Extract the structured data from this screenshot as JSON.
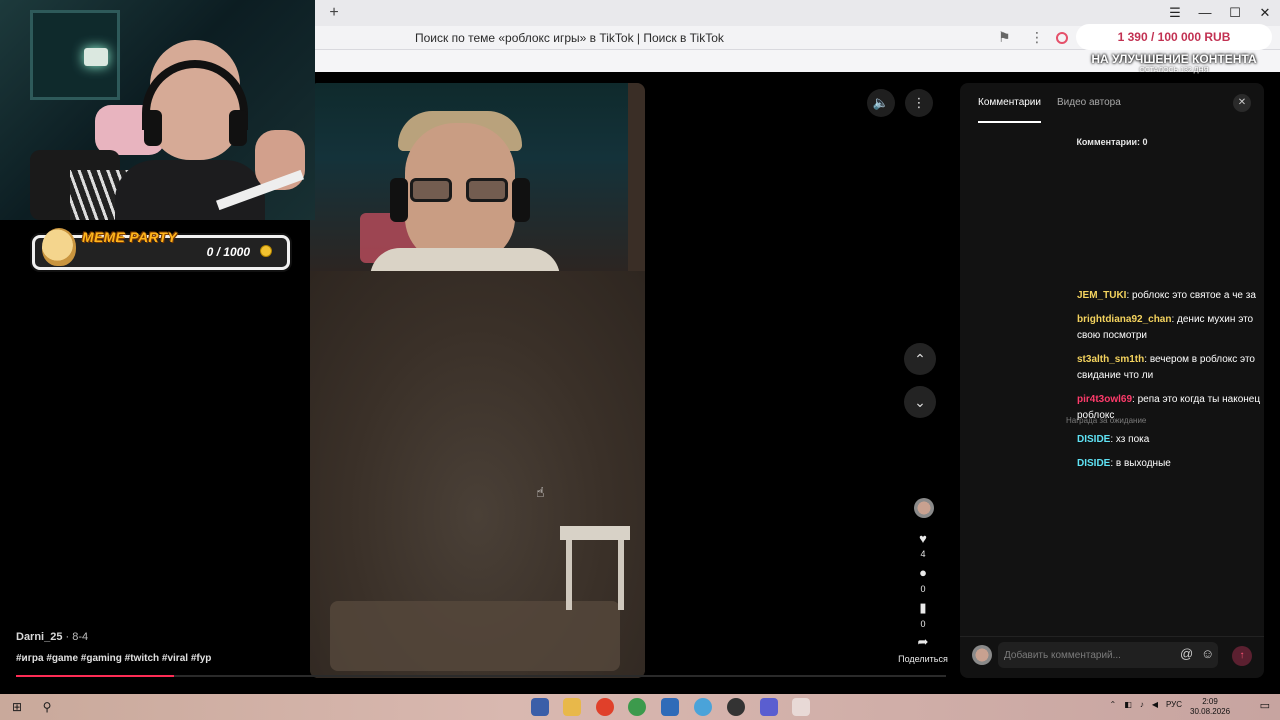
{
  "browser": {
    "page_title": "Поиск по теме «роблокс игры» в TikTok | Поиск в TikTok",
    "new_tab_glyph": "+",
    "window_controls": [
      "☰",
      "—",
      "☐",
      "✕"
    ]
  },
  "donation": {
    "amount": "1 390 / 100 000 RUB",
    "caption": "НА УЛУЧШЕНИЕ КОНТЕНТА",
    "remaining": "ОСТАЛОСЬ 132 ДНЯ"
  },
  "meme_party": {
    "title": "MEME PARTY",
    "count": "0 / 1000"
  },
  "video": {
    "author": "Darni_25",
    "date": "8-4",
    "hashtags": "#игра #game #gaming #twitch #viral #fyp",
    "progress_percent": 17
  },
  "actions": {
    "likes": "4",
    "comments": "0",
    "saves": "0",
    "share_label": "Поделиться"
  },
  "panel": {
    "tab_comments": "Комментарии",
    "tab_author_videos": "Видео автора",
    "comments_count": "Комментарии: 0",
    "input_placeholder": "Добавить комментарий...",
    "overlay_hint": "Награда за ожидание"
  },
  "chat": [
    {
      "user": "JEM_TUKI",
      "color": "#f4d35e",
      "text": "роблокс это святое а че за"
    },
    {
      "user": "brightdiana92_chan",
      "color": "#f4d35e",
      "text": "денис мухин это свою посмотри"
    },
    {
      "user": "st3alth_sm1th",
      "color": "#f4d35e",
      "text": "вечером в роблокс это свидание что ли"
    },
    {
      "user": "pir4t3owl69",
      "color": "#ff3b6b",
      "text": "репа это когда ты наконец роблокс"
    },
    {
      "user": "DISIDE",
      "color": "#5fe3f5",
      "text": "хз пока"
    },
    {
      "user": "DISIDE",
      "color": "#5fe3f5",
      "text": "в выходные"
    }
  ],
  "taskbar": {
    "tray_lang": "РУС",
    "time": "2:09",
    "date": "30.08.2026"
  },
  "colors": {
    "tiktok_red": "#fe2c55",
    "donation_red": "#c23152",
    "meme_gold": "#ffb51c"
  }
}
